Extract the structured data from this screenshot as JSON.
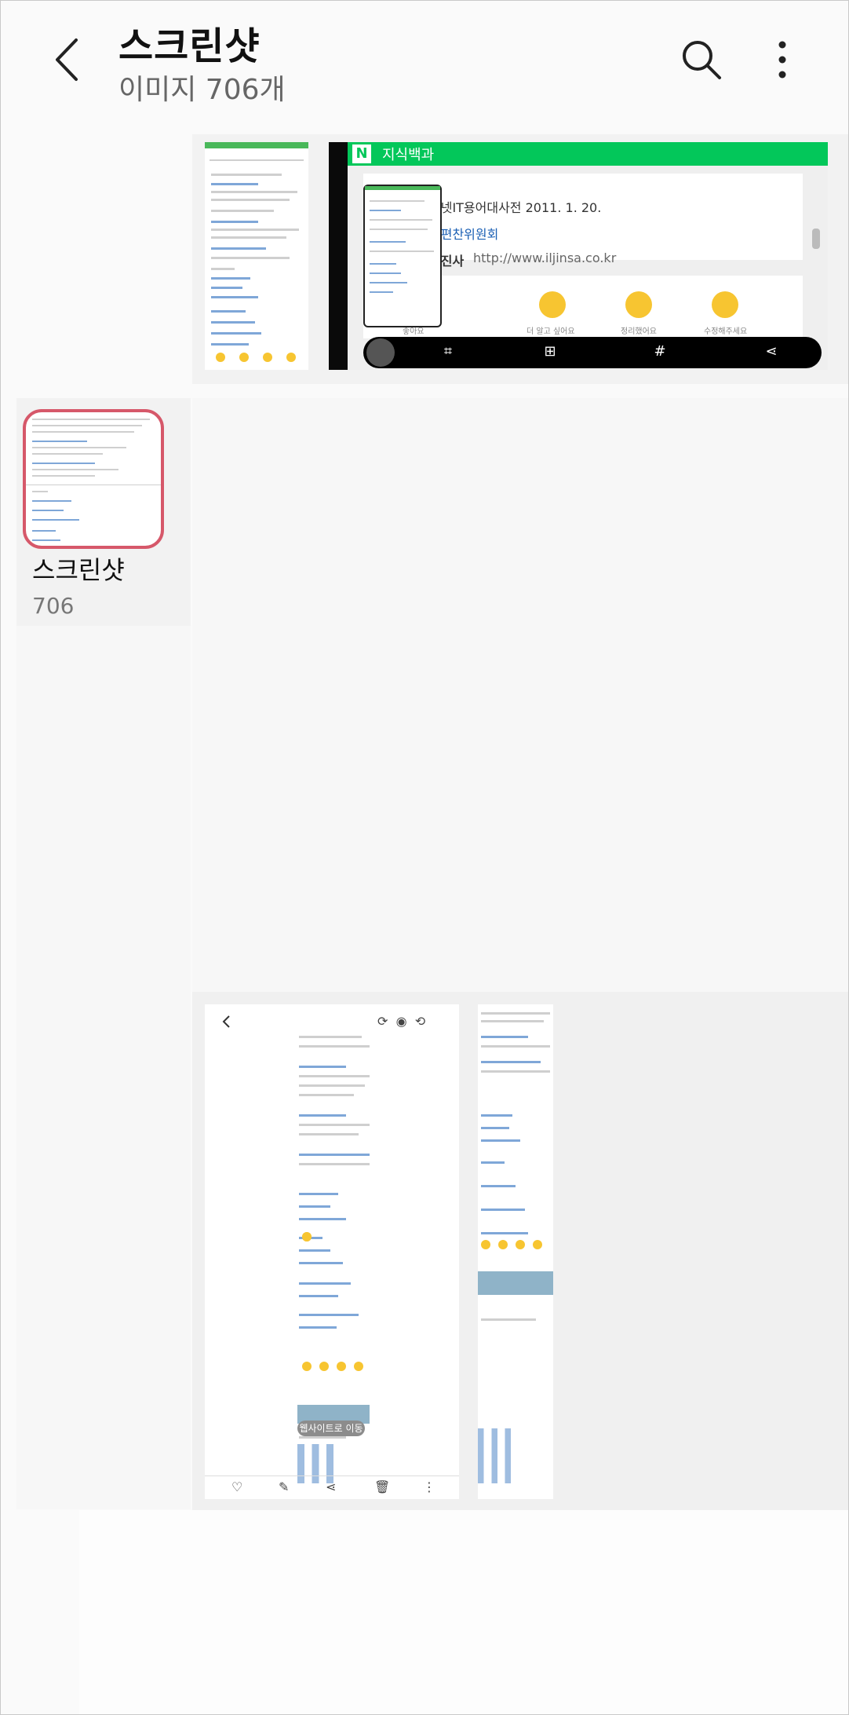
{
  "header": {
    "title": "스크린샷",
    "subtitle": "이미지 706개"
  },
  "album": {
    "name": "스크린샷",
    "count": "706"
  },
  "preview": {
    "app_title": "지식백과",
    "lines": [
      "서넷IT용어대사전 2011. 1. 20.",
      "전편찬위원회",
      "일진사",
      "http://www.iljinsa.co.kr"
    ],
    "reactions": [
      "좋아요",
      "더 알고 싶어요",
      "정리했어요",
      "수정해주세요"
    ],
    "toolbar_hash": "#"
  },
  "viewer": {
    "website_pill": "웹사이트로 이동"
  }
}
